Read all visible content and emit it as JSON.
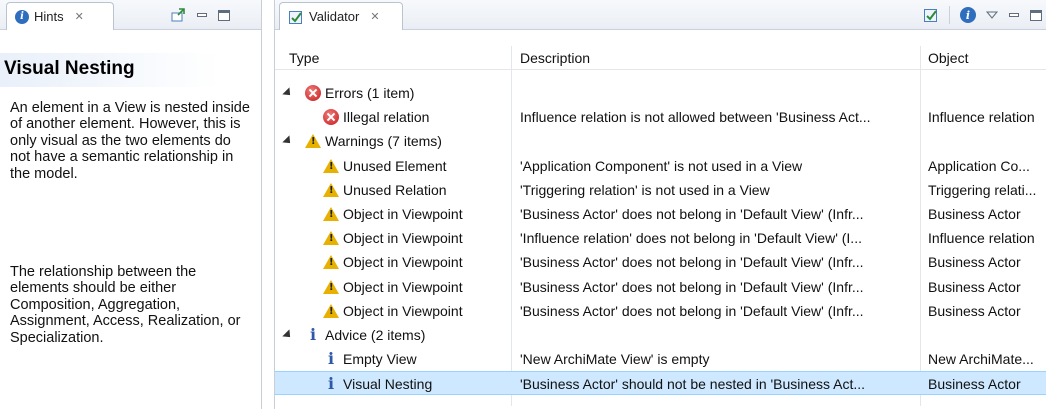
{
  "hints": {
    "tab_label": "Hints",
    "close_glyph": "✕",
    "title": "Visual Nesting",
    "paragraph1": "An element in a View is nested inside of another element. However, this is only visual as the two elements do not have a semantic relationship in the model.",
    "paragraph2": "The relationship between the elements should be either Composition, Aggregation, Assignment, Access, Realization, or Specialization."
  },
  "validator": {
    "tab_label": "Validator",
    "close_glyph": "✕",
    "columns": {
      "type": "Type",
      "description": "Description",
      "object": "Object"
    },
    "rows": [
      {
        "kind": "group",
        "icon": "error-icon",
        "type": "Errors (1 item)",
        "description": "",
        "object": ""
      },
      {
        "kind": "item",
        "icon": "error-icon",
        "type": "Illegal relation",
        "description": "Influence relation is not allowed between 'Business Act...",
        "object": "Influence relation"
      },
      {
        "kind": "group",
        "icon": "warning-icon",
        "type": "Warnings (7 items)",
        "description": "",
        "object": ""
      },
      {
        "kind": "item",
        "icon": "warning-icon",
        "type": "Unused Element",
        "description": "'Application Component' is not used in a View",
        "object": "Application Co..."
      },
      {
        "kind": "item",
        "icon": "warning-icon",
        "type": "Unused Relation",
        "description": "'Triggering relation' is not used in a View",
        "object": "Triggering relati..."
      },
      {
        "kind": "item",
        "icon": "warning-icon",
        "type": "Object in Viewpoint",
        "description": "'Business Actor' does not belong in 'Default View' (Infr...",
        "object": "Business Actor"
      },
      {
        "kind": "item",
        "icon": "warning-icon",
        "type": "Object in Viewpoint",
        "description": "'Influence relation' does not belong in 'Default View' (I...",
        "object": "Influence relation"
      },
      {
        "kind": "item",
        "icon": "warning-icon",
        "type": "Object in Viewpoint",
        "description": "'Business Actor' does not belong in 'Default View' (Infr...",
        "object": "Business Actor"
      },
      {
        "kind": "item",
        "icon": "warning-icon",
        "type": "Object in Viewpoint",
        "description": "'Business Actor' does not belong in 'Default View' (Infr...",
        "object": "Business Actor"
      },
      {
        "kind": "item",
        "icon": "warning-icon",
        "type": "Object in Viewpoint",
        "description": "'Business Actor' does not belong in 'Default View' (Infr...",
        "object": "Business Actor"
      },
      {
        "kind": "group",
        "icon": "info-icon",
        "type": "Advice (2 items)",
        "description": "",
        "object": ""
      },
      {
        "kind": "item",
        "icon": "info-icon",
        "type": "Empty View",
        "description": "'New ArchiMate View' is empty",
        "object": "New ArchiMate..."
      },
      {
        "kind": "item",
        "icon": "info-icon",
        "type": "Visual Nesting",
        "description": "'Business Actor' should not be nested in 'Business Act...",
        "object": "Business Actor",
        "selected": true
      }
    ]
  },
  "colors": {
    "selection": "#cde8ff",
    "error": "#c61a1a",
    "warning": "#e8b000",
    "info": "#2f58a8"
  }
}
